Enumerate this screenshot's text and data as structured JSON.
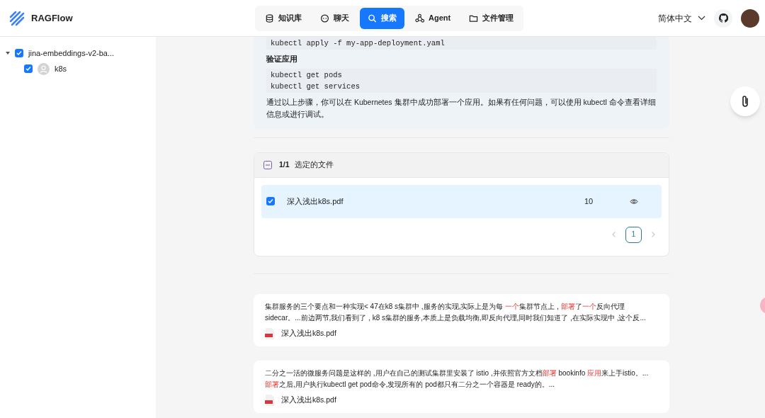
{
  "app": {
    "name": "RAGFlow"
  },
  "nav": [
    {
      "label": "知识库",
      "selected": false
    },
    {
      "label": "聊天",
      "selected": false
    },
    {
      "label": "搜索",
      "selected": true
    },
    {
      "label": "Agent",
      "selected": false
    },
    {
      "label": "文件管理",
      "selected": false
    }
  ],
  "language": "简体中文",
  "tree": [
    {
      "label": "jina-embeddings-v2-ba...",
      "checked": true,
      "expanded": true,
      "children": [
        {
          "label": "k8s",
          "checked": true
        }
      ]
    }
  ],
  "answer": [
    {
      "kind": "code",
      "lines": [
        "kubectl apply -f my-app-deployment.yaml"
      ]
    },
    {
      "kind": "heading",
      "text": "验证应用"
    },
    {
      "kind": "code",
      "lines": [
        "kubectl get pods",
        "kubectl get services"
      ]
    },
    {
      "kind": "text",
      "text": "通过以上步骤，你可以在 Kubernetes 集群中成功部署一个应用。如果有任何问题，可以使用 kubectl 命令查看详细信息或进行调试。"
    }
  ],
  "files": {
    "count": "1/1",
    "title": "选定的文件",
    "rows": [
      {
        "name": "深入浅出k8s.pdf",
        "chunks": "10",
        "checked": true
      }
    ],
    "pages": [
      {
        "label": "1",
        "selected": true
      }
    ]
  },
  "results": [
    {
      "segments": [
        {
          "text": "集群服务的三个要点和一种实现< 47在k8 s集群中 ,服务的实现,实际上是为每 ",
          "highlight": false
        },
        {
          "text": "一个",
          "highlight": true
        },
        {
          "text": "集群节点上 , ",
          "highlight": false
        },
        {
          "text": "部署",
          "highlight": true
        },
        {
          "text": "了",
          "highlight": false
        },
        {
          "text": "一个",
          "highlight": true
        },
        {
          "text": "反向代理 sidecar。...前边两节,我们看到了 , k8 s集群的服务,本质上是负载均衡,即反向代理,同时我们知道了 ,在实际实现中 ,这个反...",
          "highlight": false
        }
      ],
      "file": "深入浅出k8s.pdf"
    },
    {
      "segments": [
        {
          "text": "二分之一活的微服务问题是这样的 ,用户在自己的测试集群里安装了 istio ,并依照官方文档",
          "highlight": false
        },
        {
          "text": "部署",
          "highlight": true
        },
        {
          "text": " bookinfo ",
          "highlight": false
        },
        {
          "text": "应用",
          "highlight": true
        },
        {
          "text": "来上手istio。... ",
          "highlight": false
        },
        {
          "text": "部署",
          "highlight": true
        },
        {
          "text": "之后,用户执行kubectl get pod命令,发现所有的 pod都只有二分之一个容器是 ready的。...",
          "highlight": false
        }
      ],
      "file": "深入浅出k8s.pdf"
    }
  ]
}
